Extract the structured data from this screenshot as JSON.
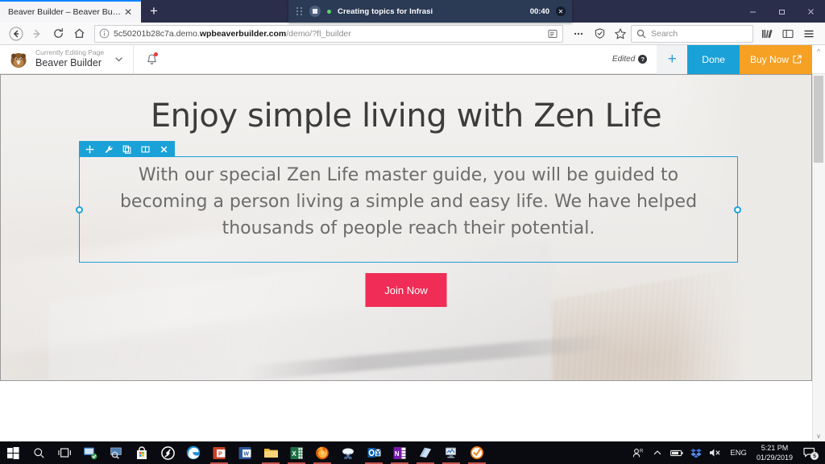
{
  "browser": {
    "tab": {
      "title": "Beaver Builder – Beaver Builder",
      "close_label": "✕"
    },
    "newtab_label": "+",
    "window_controls": {
      "minimize": "minimize-button",
      "restore": "restore-button",
      "close": "close-button"
    },
    "nav": {
      "back": "back-button",
      "forward": "forward-button",
      "reload": "reload-button",
      "home": "home-button"
    },
    "url": {
      "prefix": "5c50201b28c7a.demo.",
      "domain": "wpbeaverbuilder.com",
      "path": "/demo/?fl_builder",
      "full": "5c50201b28c7a.demo.wpbeaverbuilder.com/demo/?fl_builder"
    },
    "search": {
      "placeholder": "Search"
    },
    "toolbar_icons": [
      "reader-view-icon",
      "page-actions-icon",
      "tracking-protection-icon",
      "bookmark-star-icon",
      "library-icon",
      "sidebar-icon",
      "hamburger-menu-icon"
    ]
  },
  "recorder": {
    "title": "Creating topics for Infrasi",
    "time": "00:40",
    "close_label": "✕"
  },
  "admin_bar": {
    "subtitle": "Currently Editing Page",
    "site_name": "Beaver Builder",
    "edited_label": "Edited",
    "help_label": "?",
    "add_label": "+",
    "done_label": "Done",
    "buy_label": "Buy Now"
  },
  "page": {
    "heading": "Enjoy simple living with Zen Life",
    "paragraph": "With our special Zen Life master guide, you will be guided to becoming a person living a simple and easy life. We have helped thousands of people reach their potential.",
    "cta_label": "Join Now",
    "module_toolbar": [
      "move-icon",
      "settings-wrench-icon",
      "duplicate-icon",
      "column-icon",
      "remove-icon"
    ]
  },
  "colors": {
    "accent_blue": "#1aa1d8",
    "accent_orange": "#f6a124",
    "cta_pink": "#ef2d56",
    "tab_bar": "#2b2e4a",
    "recorder_bar": "#2b3a55"
  },
  "taskbar": {
    "items": [
      {
        "name": "start-button",
        "open": false
      },
      {
        "name": "search-taskbar-button",
        "open": false
      },
      {
        "name": "task-view-button",
        "open": false
      },
      {
        "name": "remote-desktop-icon",
        "open": false
      },
      {
        "name": "display-settings-icon",
        "open": false
      },
      {
        "name": "microsoft-store-icon",
        "open": false
      },
      {
        "name": "itunes-icon",
        "open": false
      },
      {
        "name": "edge-browser-icon",
        "open": false
      },
      {
        "name": "powerpoint-icon",
        "open": true
      },
      {
        "name": "word-icon",
        "open": false
      },
      {
        "name": "file-explorer-icon",
        "open": true
      },
      {
        "name": "excel-icon",
        "open": true
      },
      {
        "name": "firefox-icon",
        "open": true
      },
      {
        "name": "snipping-tool-icon",
        "open": false
      },
      {
        "name": "outlook-icon",
        "open": true
      },
      {
        "name": "onenote-icon",
        "open": true
      },
      {
        "name": "notes-app-icon",
        "open": true
      },
      {
        "name": "monitor-app-icon",
        "open": true
      },
      {
        "name": "check-app-icon",
        "open": true
      }
    ],
    "tray": {
      "people_icon": "people-icon",
      "show_hidden": "show-hidden-icons-chevron",
      "battery": "battery-icon",
      "dropbox": "dropbox-icon",
      "volume": "volume-muted-icon",
      "language": "ENG",
      "time": "5:21 PM",
      "date": "01/29/2019",
      "notification_count": "5"
    }
  }
}
